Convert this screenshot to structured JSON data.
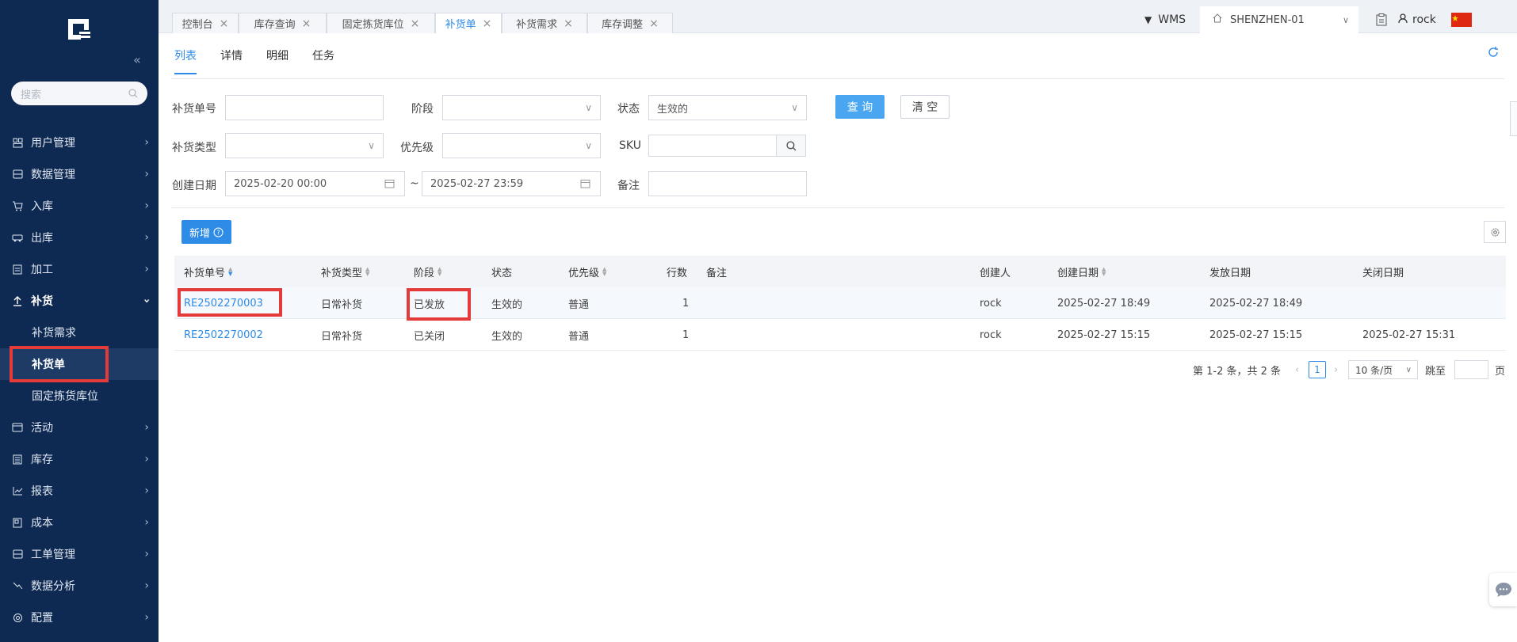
{
  "sidebar": {
    "search_placeholder": "搜索",
    "items": [
      {
        "label": "用户管理"
      },
      {
        "label": "数据管理"
      },
      {
        "label": "入库"
      },
      {
        "label": "出库"
      },
      {
        "label": "加工"
      },
      {
        "label": "补货"
      },
      {
        "label": "活动"
      },
      {
        "label": "库存"
      },
      {
        "label": "报表"
      },
      {
        "label": "成本"
      },
      {
        "label": "工单管理"
      },
      {
        "label": "数据分析"
      },
      {
        "label": "配置"
      }
    ],
    "subitems": [
      {
        "label": "补货需求"
      },
      {
        "label": "补货单"
      },
      {
        "label": "固定拣货库位"
      }
    ]
  },
  "tabs": [
    {
      "label": "控制台"
    },
    {
      "label": "库存查询"
    },
    {
      "label": "固定拣货库位"
    },
    {
      "label": "补货单"
    },
    {
      "label": "补货需求"
    },
    {
      "label": "库存调整"
    }
  ],
  "header": {
    "app": "WMS",
    "warehouse": "SHENZHEN-01",
    "user": "rock"
  },
  "subtabs": [
    {
      "label": "列表"
    },
    {
      "label": "详情"
    },
    {
      "label": "明细"
    },
    {
      "label": "任务"
    }
  ],
  "filters": {
    "order_no": {
      "label": "补货单号",
      "value": ""
    },
    "stage": {
      "label": "阶段",
      "value": ""
    },
    "status": {
      "label": "状态",
      "value": "生效的"
    },
    "type": {
      "label": "补货类型",
      "value": ""
    },
    "priority": {
      "label": "优先级",
      "value": ""
    },
    "sku": {
      "label": "SKU",
      "value": ""
    },
    "created": {
      "label": "创建日期",
      "from": "2025-02-20 00:00",
      "sep": "~",
      "to": "2025-02-27 23:59"
    },
    "remark": {
      "label": "备注",
      "value": ""
    },
    "query_button": "查 询",
    "clear_button": "清 空"
  },
  "toolbar": {
    "new_button": "新增"
  },
  "table": {
    "headers": [
      "补货单号",
      "补货类型",
      "阶段",
      "状态",
      "优先级",
      "行数",
      "备注",
      "创建人",
      "创建日期",
      "发放日期",
      "关闭日期"
    ],
    "rows": [
      [
        "RE2502270003",
        "日常补货",
        "已发放",
        "生效的",
        "普通",
        "1",
        "",
        "rock",
        "2025-02-27 18:49",
        "2025-02-27 18:49",
        ""
      ],
      [
        "RE2502270002",
        "日常补货",
        "已关闭",
        "生效的",
        "普通",
        "1",
        "",
        "rock",
        "2025-02-27 15:15",
        "2025-02-27 15:15",
        "2025-02-27 15:31"
      ]
    ]
  },
  "pagination": {
    "summary": "第 1-2 条，共 2 条",
    "current_page": "1",
    "page_size": "10 条/页",
    "jump_label": "跳至",
    "page_suffix": "页"
  },
  "colors": {
    "sidebar": "#0f2a52",
    "accent": "#2e8be6",
    "highlight": "#e53a3a"
  }
}
